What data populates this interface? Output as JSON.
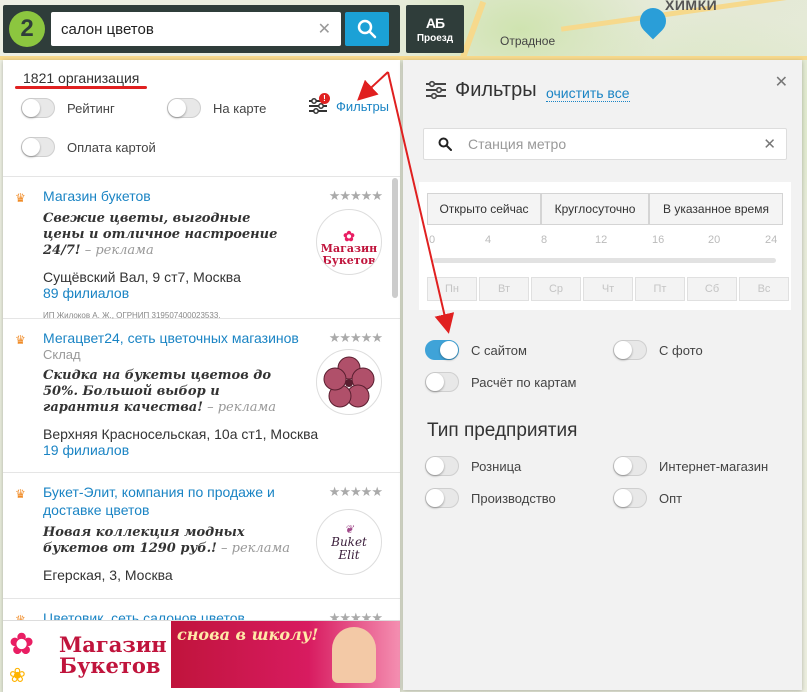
{
  "search": {
    "value": "салон цветов"
  },
  "route_button": {
    "glyph": "АБ",
    "label": "Проезд"
  },
  "map": {
    "labels": [
      "Отрадное",
      "ХИМКИ"
    ]
  },
  "results": {
    "count": "1821 организация",
    "toggles": [
      {
        "label": "Рейтинг",
        "on": false
      },
      {
        "label": "На карте",
        "on": false
      },
      {
        "label": "Оплата картой",
        "on": false
      }
    ],
    "filters_link": "Фильтры",
    "filters_badge": "!",
    "items": [
      {
        "title": "Магазин букетов",
        "subtitle": "",
        "rating": 5,
        "stars": "★★★★★",
        "ad_text": "Свежие цветы, выгодные цены и отличное настроение 24/7!",
        "ad_tag": " – реклама",
        "address": "Сущёвский Вал, 9 ст7, Москва",
        "branches": "89 филиалов",
        "legal": "ИП Жилоков А. Ж., ОГРНИП 319507400023533.",
        "logo_text_1": "Магазин",
        "logo_text_2": "Букетов"
      },
      {
        "title": "Мегацвет24, сеть цветочных магазинов",
        "subtitle": "Склад",
        "rating": 4.5,
        "stars": "★★★★★",
        "ad_text": "Скидка на букеты цветов до 50%. Большой выбор и гарантия качества!",
        "ad_tag": " – реклама",
        "address": "Верхняя Красносельская, 10а ст1, Москва",
        "branches": "19 филиалов"
      },
      {
        "title": "Букет-Элит, компания по продаже и доставке цветов",
        "subtitle": "",
        "rating": 4,
        "stars": "★★★★★",
        "ad_text": "Новая коллекция модных букетов от 1290 руб.!",
        "ad_tag": " – реклама",
        "address": "Егерская, 3, Москва",
        "logo_text_1": "Buket",
        "logo_text_2": "Elit"
      },
      {
        "title": "Цветовик, сеть салонов цветов",
        "rating": 4.5,
        "stars": "★★★★★"
      }
    ]
  },
  "banner": {
    "title_1": "Магазин",
    "title_2": "Букетов",
    "slogan": "снова в школу!"
  },
  "filters": {
    "title": "Фильтры",
    "clear_all": "очистить все",
    "metro_placeholder": "Станция метро",
    "hour_tabs": [
      "Открыто сейчас",
      "Круглосуточно",
      "В указанное время"
    ],
    "hour_ticks": [
      "0",
      "4",
      "8",
      "12",
      "16",
      "20",
      "24"
    ],
    "days": [
      "Пн",
      "Вт",
      "Ср",
      "Чт",
      "Пт",
      "Сб",
      "Вс"
    ],
    "toggles": [
      {
        "label": "С сайтом",
        "on": true
      },
      {
        "label": "С фото",
        "on": false
      },
      {
        "label": "Расчёт по картам",
        "on": false
      }
    ],
    "type_title": "Тип предприятия",
    "type_toggles": [
      {
        "label": "Розница",
        "on": false
      },
      {
        "label": "Интернет-магазин",
        "on": false
      },
      {
        "label": "Производство",
        "on": false
      },
      {
        "label": "Опт",
        "on": false
      }
    ]
  },
  "colors": {
    "accent": "#1a84c4",
    "search_button": "#1ba1d6",
    "annotation": "#e02020",
    "toggle_on": "#3fa3d8",
    "crown": "#f08a24"
  }
}
